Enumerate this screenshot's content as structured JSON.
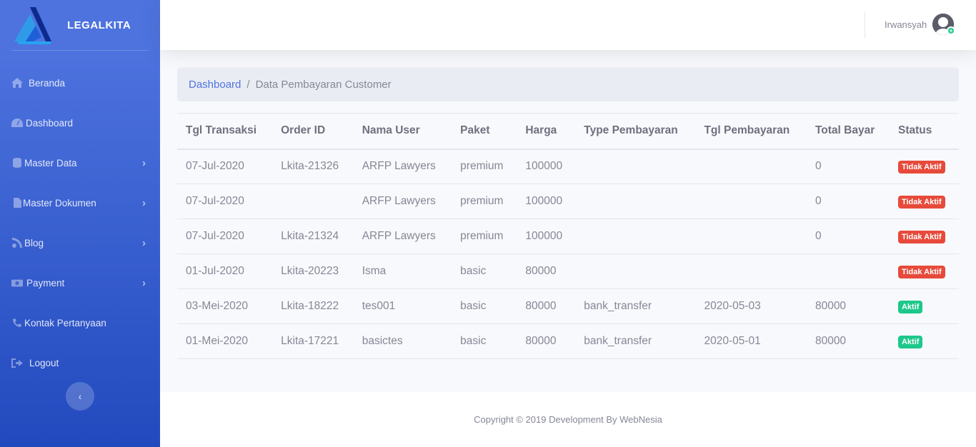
{
  "brand": {
    "name": "LEGALKITA"
  },
  "sidebar": {
    "items": [
      {
        "label": "Beranda",
        "icon": "home-icon",
        "has_submenu": false
      },
      {
        "label": "Dashboard",
        "icon": "tachometer-icon",
        "has_submenu": false
      },
      {
        "label": "Master Data",
        "icon": "database-icon",
        "has_submenu": true
      },
      {
        "label": "Master Dokumen",
        "icon": "file-icon",
        "has_submenu": true
      },
      {
        "label": "Blog",
        "icon": "blog-icon",
        "has_submenu": true
      },
      {
        "label": "Payment",
        "icon": "money-icon",
        "has_submenu": true
      },
      {
        "label": "Kontak Pertanyaan",
        "icon": "phone-icon",
        "has_submenu": false
      },
      {
        "label": "Logout",
        "icon": "sign-out-icon",
        "has_submenu": false
      }
    ],
    "toggle_icon": "chevron-left-icon"
  },
  "topbar": {
    "user_name": "Irwansyah"
  },
  "breadcrumb": {
    "home": "Dashboard",
    "separator": "/",
    "current": "Data Pembayaran Customer"
  },
  "table": {
    "headers": [
      "Tgl Transaksi",
      "Order ID",
      "Nama User",
      "Paket",
      "Harga",
      "Type Pembayaran",
      "Tgl Pembayaran",
      "Total Bayar",
      "Status"
    ],
    "rows": [
      [
        "07-Jul-2020",
        "Lkita-21326",
        "ARFP Lawyers",
        "premium",
        "100000",
        "",
        "",
        "0",
        "Tidak Aktif"
      ],
      [
        "07-Jul-2020",
        "",
        "ARFP Lawyers",
        "premium",
        "100000",
        "",
        "",
        "0",
        "Tidak Aktif"
      ],
      [
        "07-Jul-2020",
        "Lkita-21324",
        "ARFP Lawyers",
        "premium",
        "100000",
        "",
        "",
        "0",
        "Tidak Aktif"
      ],
      [
        "01-Jul-2020",
        "Lkita-20223",
        "Isma",
        "basic",
        "80000",
        "",
        "",
        "",
        "Tidak Aktif"
      ],
      [
        "03-Mei-2020",
        "Lkita-18222",
        "tes001",
        "basic",
        "80000",
        "bank_transfer",
        "2020-05-03",
        "80000",
        "Aktif"
      ],
      [
        "01-Mei-2020",
        "Lkita-17221",
        "basictes",
        "basic",
        "80000",
        "bank_transfer",
        "2020-05-01",
        "80000",
        "Aktif"
      ]
    ]
  },
  "footer": {
    "text": "Copyright © 2019 Development By WebNesia"
  },
  "colors": {
    "sidebar_top": "#4e73df",
    "sidebar_bottom": "#224abe",
    "danger": "#e74a3b",
    "success": "#1cc88a",
    "link": "#4e73df"
  }
}
